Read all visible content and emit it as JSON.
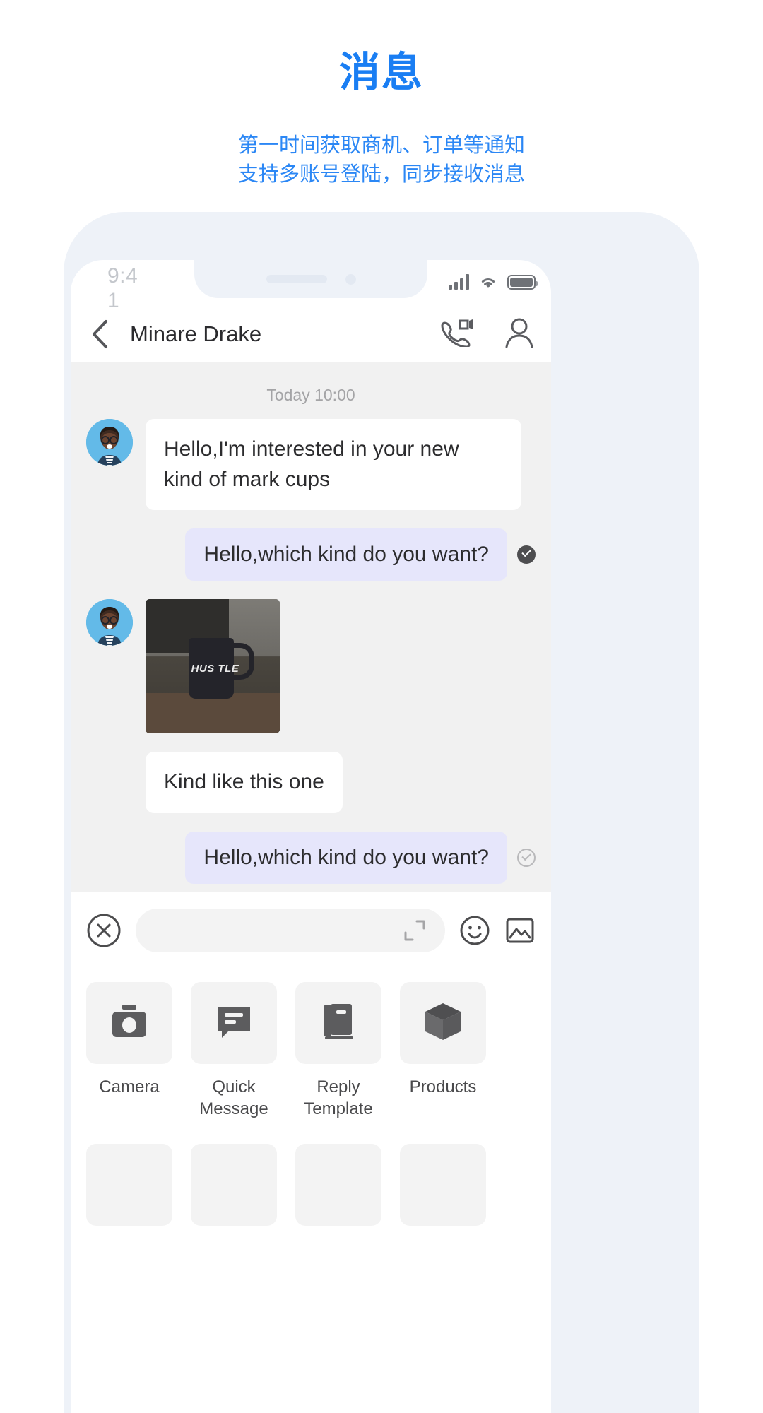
{
  "promo": {
    "title": "消息",
    "subtitle_line1": "第一时间获取商机、订单等通知",
    "subtitle_line2": "支持多账号登陆，同步接收消息",
    "accent_color": "#1a7ef3",
    "subtitle_color": "#2b87f5"
  },
  "status_bar": {
    "time": "9:41",
    "icons": [
      "signal-icon",
      "wifi-icon",
      "battery-icon"
    ]
  },
  "nav": {
    "back_icon": "chevron-left-icon",
    "title": "Minare Drake",
    "video_call_icon": "video-call-icon",
    "profile_icon": "person-icon"
  },
  "chat": {
    "timestamp": "Today 10:00",
    "background": "#f1f1f1",
    "incoming_bubble_color": "#ffffff",
    "outgoing_bubble_color": "#e6e6fb",
    "messages": [
      {
        "id": 1,
        "direction": "incoming",
        "type": "text",
        "text": "Hello,I'm interested in your new kind of mark cups",
        "avatar": "contact-avatar"
      },
      {
        "id": 2,
        "direction": "outgoing",
        "type": "text",
        "text": "Hello,which kind do you want?",
        "status_icon": "read-check-filled"
      },
      {
        "id": 3,
        "direction": "incoming",
        "type": "image",
        "image_alt": "dark-mug-photo",
        "image_text": "HUS TLE",
        "avatar": "contact-avatar"
      },
      {
        "id": 4,
        "direction": "incoming",
        "type": "text",
        "text": "Kind like this one"
      },
      {
        "id": 5,
        "direction": "outgoing",
        "type": "text",
        "text": "Hello,which kind do you want?",
        "status_icon": "read-check-outline"
      }
    ]
  },
  "input_bar": {
    "close_icon": "close-circle-icon",
    "field_value": "",
    "field_placeholder": "",
    "expand_icon": "expand-icon",
    "emoji_icon": "emoji-smiley-icon",
    "image_icon": "image-icon"
  },
  "action_panel": {
    "items": [
      {
        "icon": "camera-icon",
        "label": "Camera"
      },
      {
        "icon": "quick-message-icon",
        "label": "Quick\nMessage",
        "label_l1": "Quick",
        "label_l2": "Message"
      },
      {
        "icon": "reply-template-icon",
        "label": "Reply\nTemplate",
        "label_l1": "Reply",
        "label_l2": "Template"
      },
      {
        "icon": "products-box-icon",
        "label": "Products"
      }
    ]
  }
}
